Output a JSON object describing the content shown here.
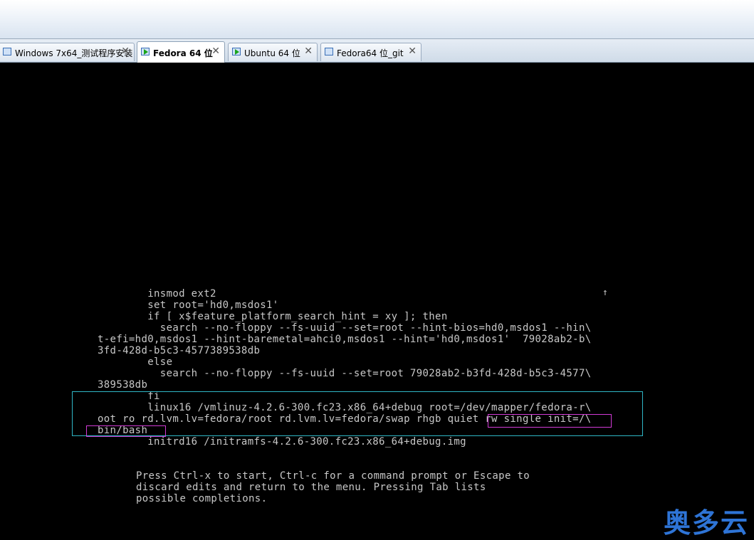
{
  "tabs": [
    {
      "label": "Windows 7x64_测试程序安装",
      "active": false,
      "running": false
    },
    {
      "label": "Fedora 64 位",
      "active": true,
      "running": true
    },
    {
      "label": "Ubuntu 64 位",
      "active": false,
      "running": true
    },
    {
      "label": "Fedora64 位_git",
      "active": false,
      "running": false
    }
  ],
  "close_glyph": "✕",
  "terminal": {
    "lines": [
      "        insmod ext2",
      "        set root='hd0,msdos1'",
      "        if [ x$feature_platform_search_hint = xy ]; then",
      "          search --no-floppy --fs-uuid --set=root --hint-bios=hd0,msdos1 --hin\\",
      "t-efi=hd0,msdos1 --hint-baremetal=ahci0,msdos1 --hint='hd0,msdos1'  79028ab2-b\\",
      "3fd-428d-b5c3-4577389538db",
      "        else",
      "          search --no-floppy --fs-uuid --set=root 79028ab2-b3fd-428d-b5c3-4577\\",
      "389538db",
      "        fi",
      "        linux16 /vmlinuz-4.2.6-300.fc23.x86_64+debug root=/dev/mapper/fedora-r\\",
      "oot ro rd.lvm.lv=fedora/root rd.lvm.lv=fedora/swap rhgb quiet rw single init=/\\",
      "bin/bash_",
      "        initrd16 /initramfs-4.2.6-300.fc23.x86_64+debug.img"
    ],
    "scroll_indicator": "↑",
    "help_lines": [
      "Press Ctrl-x to start, Ctrl-c for a command prompt or Escape to",
      "discard edits and return to the menu. Pressing Tab lists",
      "possible completions."
    ]
  },
  "watermark": "奥多云",
  "colors": {
    "highlight_cyan": "#2fb7c6",
    "highlight_magenta": "#d23bd6",
    "watermark": "#2e74d6",
    "terminal_text": "#c8c8c8"
  }
}
